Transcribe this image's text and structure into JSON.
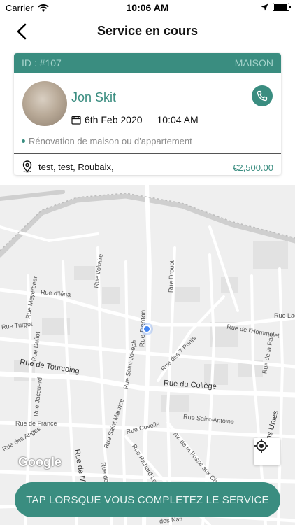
{
  "status_bar": {
    "carrier": "Carrier",
    "time": "10:06 AM"
  },
  "nav": {
    "title": "Service en cours"
  },
  "card": {
    "id_label": "ID : #107",
    "category": "MAISON",
    "client_name": "Jon Skit",
    "date": "6th Feb 2020",
    "time": "10:04 AM",
    "service": "Rénovation de maison ou d'appartement",
    "address": "test, test, Roubaix,",
    "price": "€2,500.00"
  },
  "map": {
    "streets": {
      "tourcoing": "Rue de Tourcoing",
      "college": "Rue du Collège",
      "denton": "Rue Denton",
      "voltaire": "Rue Voltaire",
      "drouot": "Rue Drouot",
      "jena": "Rue d'Iéna",
      "meyerbeer": "Rue Meyerbeer",
      "turgot": "Rue Turgot",
      "dufiot": "Rue Dufiot",
      "jacquard": "Rue Jacquard",
      "france": "Rue de France",
      "anges": "Rue des Anges",
      "st_joseph": "Rue Saint-Joseph",
      "sept_ponts": "Rue des 7 Ponts",
      "hommelet": "Rue de l'Hommelet",
      "paix": "Rue de la Paix",
      "st_maurice": "Rue Saint Maurice",
      "st_antoine": "Rue Saint-Antoine",
      "cuvelle": "Rue Cuvelle",
      "richard_lenoir": "Rue Richard Lenoir",
      "fosse_aux_chenes": "Av. de la Fosse aux Chênes",
      "nations_unies": "Nations Unies",
      "lac": "Rue Lac",
      "alma": "Rue de l'Al",
      "rue_b": "Rue de B",
      "nati": "des Nati"
    },
    "attribution": "Google"
  },
  "action": {
    "complete_label": "TAP LORSQUE VOUS COMPLETEZ LE SERVICE"
  },
  "colors": {
    "accent": "#3a8d80",
    "location": "#4285f4"
  }
}
